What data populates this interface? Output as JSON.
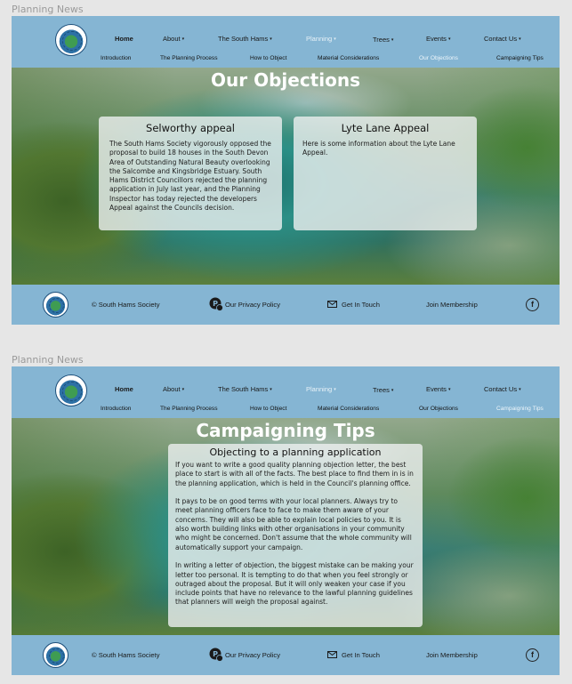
{
  "frames": [
    {
      "label": "Planning News",
      "nav": {
        "home": "Home",
        "about": "About",
        "south_hams": "The South Hams",
        "planning": "Planning",
        "trees": "Trees",
        "events": "Events",
        "contact": "Contact Us"
      },
      "subnav": {
        "introduction": "Introduction",
        "process": "The Planning Process",
        "how_to_object": "How to Object",
        "material": "Material Considerations",
        "objections": "Our Objections",
        "campaigning": "Campaigning Tips"
      },
      "hero_title": "Our Objections",
      "cards": [
        {
          "title": "Selworthy appeal",
          "body": "The South Hams Society vigorously opposed the proposal to build 18 houses in the South Devon Area of Outstanding Natural Beauty overlooking the Salcombe and Kingsbridge Estuary. South Hams District Councillors rejected the planning application in July last year, and  the Planning Inspector has today rejected the developers Appeal against the Councils decision."
        },
        {
          "title": "Lyte Lane Appeal",
          "body": "Here is some information about the Lyte Lane Appeal."
        }
      ],
      "footer": {
        "copyright": "© South Hams Society",
        "privacy": "Our Privacy Policy",
        "contact": "Get In Touch",
        "membership": "Join Membership",
        "facebook": "f"
      }
    },
    {
      "label": "Planning News",
      "nav": {
        "home": "Home",
        "about": "About",
        "south_hams": "The South Hams",
        "planning": "Planning",
        "trees": "Trees",
        "events": "Events",
        "contact": "Contact Us"
      },
      "subnav": {
        "introduction": "Introduction",
        "process": "The Planning Process",
        "how_to_object": "How to Object",
        "material": "Material Considerations",
        "objections": "Our Objections",
        "campaigning": "Campaigning Tips"
      },
      "hero_title": "Campaigning Tips",
      "cards": [
        {
          "title": "Objecting to a planning application",
          "paragraphs": [
            "If you want to write a good quality planning objection letter, the best place to start is with all of the facts. The best place to find them in is in the planning application, which is held in the Council's planning office.",
            "It pays to be on good terms with your local planners. Always try to meet planning officers face to face to make them aware of your concerns. They will also be able to explain local policies to you. It is also worth building links with other organisations in your community who might be concerned. Don't assume that the whole community will automatically support your campaign.",
            "In writing a letter of objection, the biggest mistake can be making your letter too personal. It is tempting to do that when you feel strongly or outraged about the proposal. But it will only weaken your case if you include points that have no relevance to the lawful planning guidelines that planners will weigh the proposal against."
          ]
        }
      ],
      "footer": {
        "copyright": "© South Hams Society",
        "privacy": "Our Privacy Policy",
        "contact": "Get In Touch",
        "membership": "Join Membership",
        "facebook": "f"
      }
    }
  ],
  "icons": {
    "caret": "▾",
    "privacy": "privacy-icon",
    "mail": "mail-icon",
    "facebook": "facebook-icon"
  },
  "colors": {
    "header_bg": "#85b5d3",
    "footer_bg": "#85b5d3",
    "active_nav": "#e8f2f8",
    "card_bg": "rgba(238,240,240,0.80)"
  }
}
